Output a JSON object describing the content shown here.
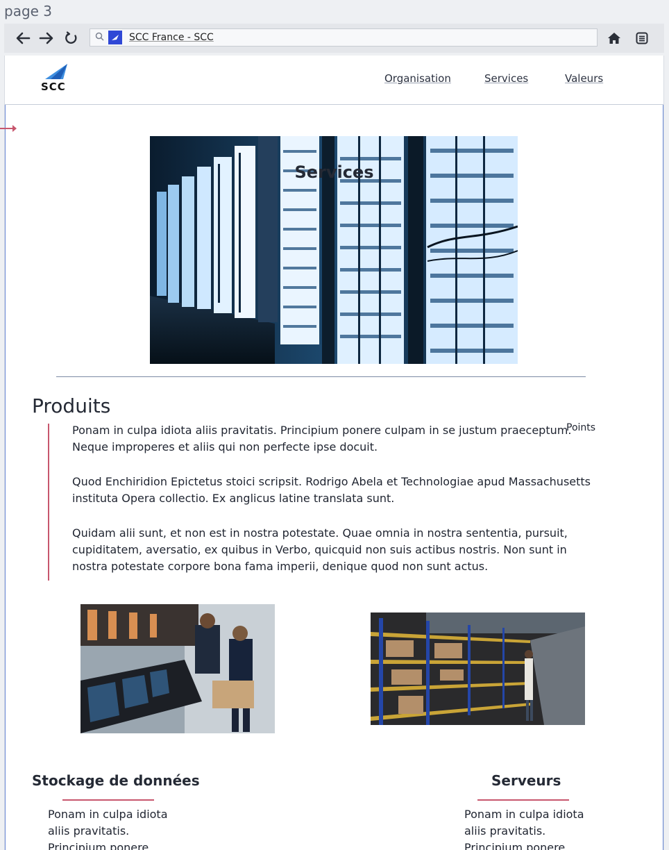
{
  "page_label": "page 3",
  "browser": {
    "url_text": "SCC France - SCC",
    "icons": [
      "back-arrow-icon",
      "forward-arrow-icon",
      "reload-icon",
      "search-icon",
      "favicon",
      "home-icon",
      "menu-icon"
    ]
  },
  "header": {
    "logo_text": "SCC",
    "nav": [
      "Organisation",
      "Services",
      "Valeurs"
    ]
  },
  "section_title": "Services",
  "produits": {
    "heading": "Produits",
    "side_note": "Points",
    "paragraphs": [
      "Ponam in culpa idiota aliis pravitatis. Principium ponere culpam in se justum praeceptum. Neque improperes et aliis qui non perfecte ipse docuit.",
      "Quod Enchiridion Epictetus stoici scripsit. Rodrigo Abela et Technologiae apud Massachusetts instituta Opera collectio. Ex anglicus latine translata sunt.",
      "Quidam alii sunt, et non est in nostra potestate. Quae omnia in nostra sententia, pursuit, cupiditatem, aversatio, ex quibus in Verbo, quicquid non suis actibus nostris. Non sunt in nostra potestate corpore bona fama imperii, denique quod non sunt actus."
    ]
  },
  "cards": [
    {
      "title": "Stockage de données",
      "body": "Ponam in culpa idiota aliis pravitatis. Principium ponere"
    },
    {
      "title": "Serveurs",
      "body": "Ponam in culpa idiota aliis pravitatis. Principium ponere"
    }
  ],
  "colors": {
    "accent": "#c7566d",
    "favicon": "#2f47d6",
    "logo_blue": "#3f8fe0"
  }
}
